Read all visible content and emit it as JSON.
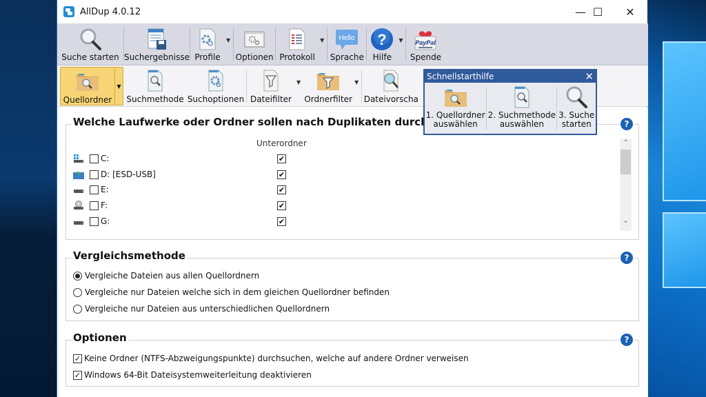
{
  "window": {
    "title": "AllDup 4.0.12",
    "minimize": "—",
    "maximize": "☐",
    "close": "✕"
  },
  "toolbar_main": [
    {
      "label": "Suche starten",
      "icon": "magnifier-icon"
    },
    {
      "label": "Suchergebnisse",
      "icon": "results-save-icon"
    },
    {
      "label": "Profile",
      "icon": "profile-gear-icon",
      "dropdown": true
    },
    {
      "label": "Optionen",
      "icon": "options-gear-icon"
    },
    {
      "label": "Protokoll",
      "icon": "log-icon",
      "dropdown": true
    },
    {
      "label": "Sprache",
      "icon": "hello-bubble-icon",
      "icon_text": "Hello"
    },
    {
      "label": "Hilfe",
      "icon": "help-icon",
      "dropdown": true
    },
    {
      "label": "Spende",
      "icon": "paypal-icon",
      "icon_text": "PayPal"
    }
  ],
  "toolbar_sub": [
    {
      "label": "Quellordner",
      "icon": "folder-search-icon",
      "active": true,
      "dropdown": true
    },
    {
      "label": "Suchmethode",
      "icon": "document-search-icon"
    },
    {
      "label": "Suchoptionen",
      "icon": "document-gear-icon"
    },
    {
      "label": "Dateifilter",
      "icon": "document-filter-icon",
      "dropdown": true
    },
    {
      "label": "Ordnerfilter",
      "icon": "folder-filter-icon",
      "dropdown": true
    },
    {
      "label": "Dateivorscha",
      "icon": "file-preview-icon"
    }
  ],
  "quickstart": {
    "title": "Schnellstarthilfe",
    "close": "✕",
    "steps": [
      {
        "line1": "1. Quellordner",
        "line2": "auswählen"
      },
      {
        "line1": "2. Suchmethode",
        "line2": "auswählen"
      },
      {
        "line1": "3. Suche",
        "line2": "starten"
      }
    ]
  },
  "drives_group": {
    "title": "Welche Laufwerke oder Ordner sollen nach Duplikaten durchsuc",
    "subfolder_header": "Unterordner",
    "help": "?",
    "drives": [
      {
        "label": "C:",
        "icon": "windows-drive-icon",
        "checked": false,
        "subfolders": true
      },
      {
        "label": "D: [ESD-USB]",
        "icon": "usb-drive-icon",
        "checked": false,
        "subfolders": true
      },
      {
        "label": "E:",
        "icon": "hard-drive-icon",
        "checked": false,
        "subfolders": true
      },
      {
        "label": "F:",
        "icon": "optical-drive-icon",
        "checked": false,
        "subfolders": true
      },
      {
        "label": "G:",
        "icon": "hard-drive-icon",
        "checked": false,
        "subfolders": true
      }
    ],
    "scroll_up": "˄",
    "scroll_down": "˅"
  },
  "compare_group": {
    "title": "Vergleichsmethode",
    "help": "?",
    "options": [
      {
        "label": "Vergleiche Dateien aus allen Quellordnern",
        "selected": true
      },
      {
        "label": "Vergleiche nur Dateien welche sich in dem gleichen Quellordner befinden",
        "selected": false
      },
      {
        "label": "Vergleiche nur Dateien aus unterschiedlichen Quellordnern",
        "selected": false
      }
    ]
  },
  "options_group": {
    "title": "Optionen",
    "help": "?",
    "options": [
      {
        "label": "Keine Ordner (NTFS-Abzweigungspunkte) durchsuchen, welche auf andere Ordner verweisen",
        "checked": true
      },
      {
        "label": "Windows 64-Bit Dateisystemweiterleitung deaktivieren",
        "checked": true
      }
    ]
  },
  "check_mark": "✔",
  "check_mark_light": "✓",
  "icon_text": {
    "hello": "Hello",
    "paypal": "PayPal",
    "help": "?"
  }
}
